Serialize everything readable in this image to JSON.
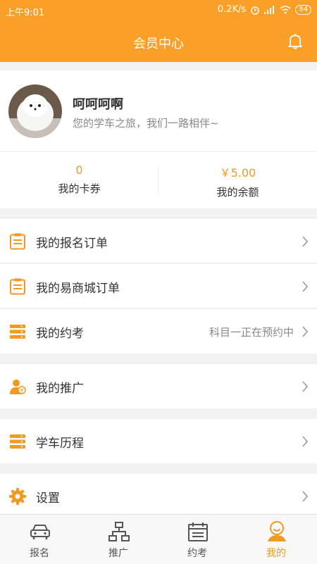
{
  "status_bar": {
    "time": "上午9:01",
    "speed": "0.2K/s",
    "battery": "84"
  },
  "header": {
    "title": "会员中心",
    "bell_icon": "bell-icon"
  },
  "profile": {
    "name": "呵呵呵啊",
    "motto": "您的学车之旅，我们一路相伴~"
  },
  "stats": [
    {
      "value": "0",
      "label": "我的卡券"
    },
    {
      "value": "￥5.00",
      "label": "我的余额"
    }
  ],
  "menu": [
    {
      "label": "我的报名订单",
      "status": "",
      "icon": "clipboard-icon"
    },
    {
      "label": "我的易商城订单",
      "status": "",
      "icon": "clipboard-icon"
    },
    {
      "label": "我的约考",
      "status": "科目一正在预约中",
      "icon": "stack-icon"
    },
    {
      "label": "我的推广",
      "status": "",
      "icon": "promote-icon"
    },
    {
      "label": "学车历程",
      "status": "",
      "icon": "stack-icon"
    },
    {
      "label": "设置",
      "status": "",
      "icon": "gear-icon"
    }
  ],
  "tabs": [
    {
      "label": "报名",
      "icon": "car-icon"
    },
    {
      "label": "推广",
      "icon": "org-chart-icon"
    },
    {
      "label": "约考",
      "icon": "calendar-icon"
    },
    {
      "label": "我的",
      "icon": "user-icon",
      "active": true
    }
  ],
  "colors": {
    "accent": "#faa028",
    "accent_text": "#f29a1f",
    "background": "#f2f2f2"
  }
}
